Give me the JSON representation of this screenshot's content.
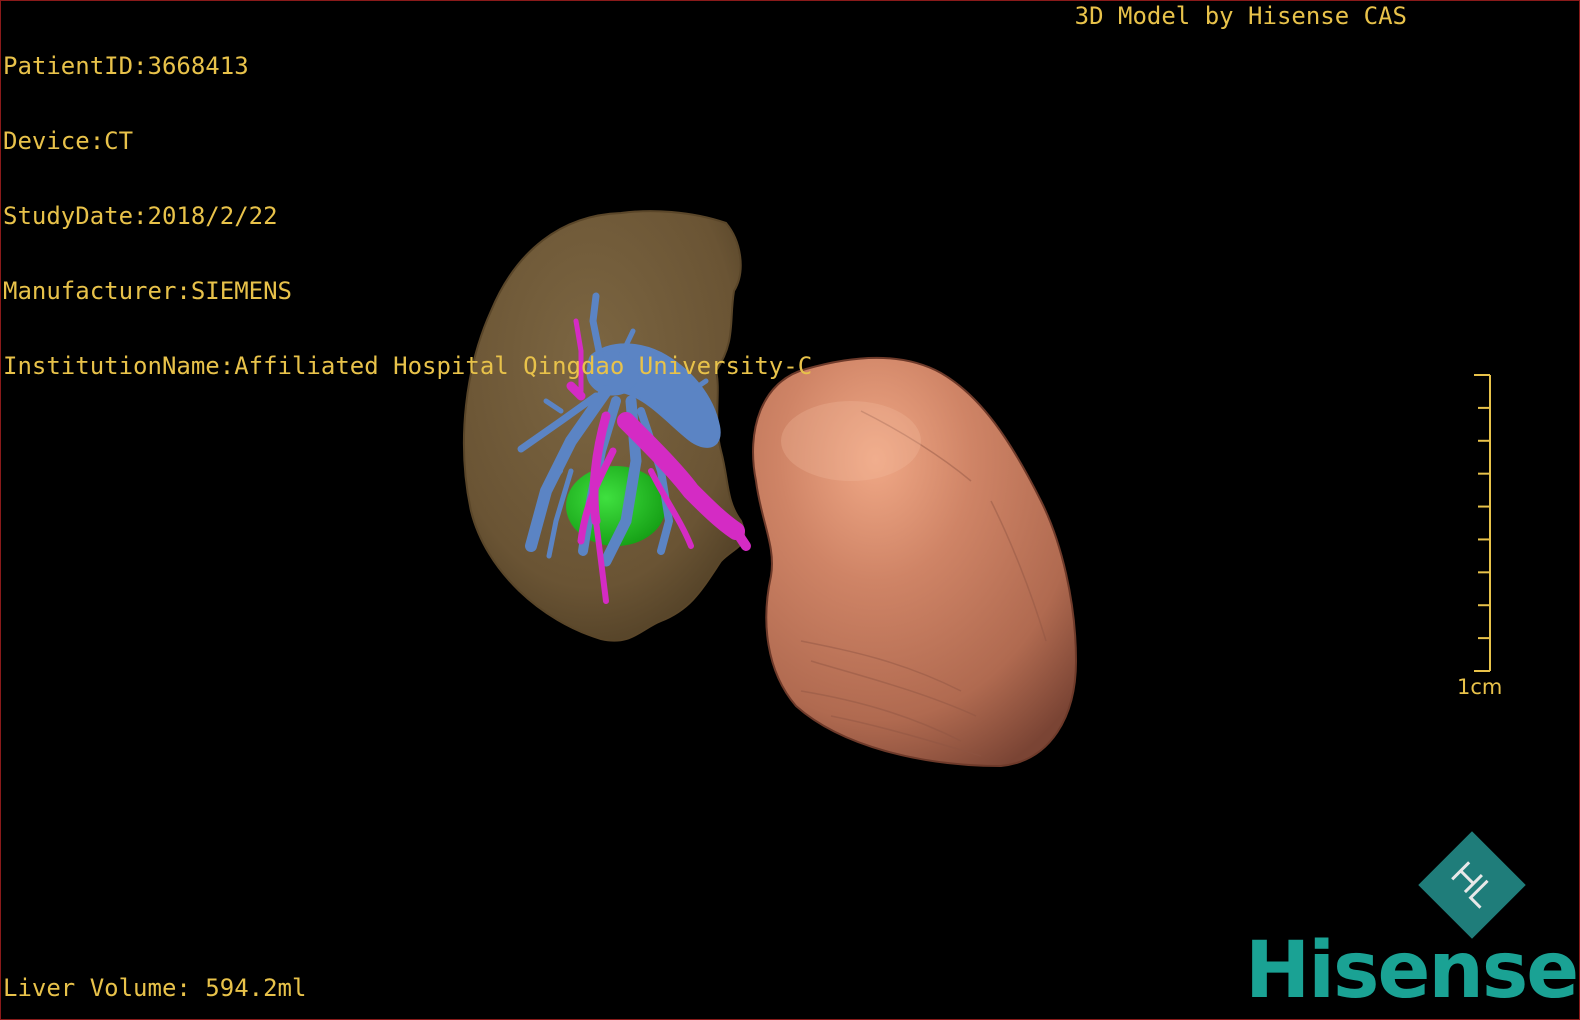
{
  "header": {
    "lines": [
      "PatientID:3668413",
      "Device:CT",
      "StudyDate:2018/2/22",
      "Manufacturer:SIEMENS",
      "InstitutionName:Affiliated Hospital Qingdao University-C"
    ],
    "model_credit": "3D Model by Hisense CAS"
  },
  "footer": {
    "liver_volume": "Liver Volume: 594.2ml"
  },
  "scale_bar": {
    "label": "1cm",
    "tick_count": 10
  },
  "logo": {
    "wordmark": "Hisense",
    "emblem_icon": "hisense-diamond-icon",
    "brand_color": "#1aa294"
  },
  "scene": {
    "structures": [
      {
        "name": "liver",
        "color": "#6e5838"
      },
      {
        "name": "kidney",
        "color": "#c2785e"
      },
      {
        "name": "portal-vein",
        "color": "#5b84c4"
      },
      {
        "name": "hepatic-artery",
        "color": "#d42bc4"
      },
      {
        "name": "tumor",
        "color": "#1fba1f"
      }
    ]
  },
  "colors": {
    "overlay_text": "#e8c24a",
    "background": "#000000",
    "border": "#8a1a1a"
  }
}
